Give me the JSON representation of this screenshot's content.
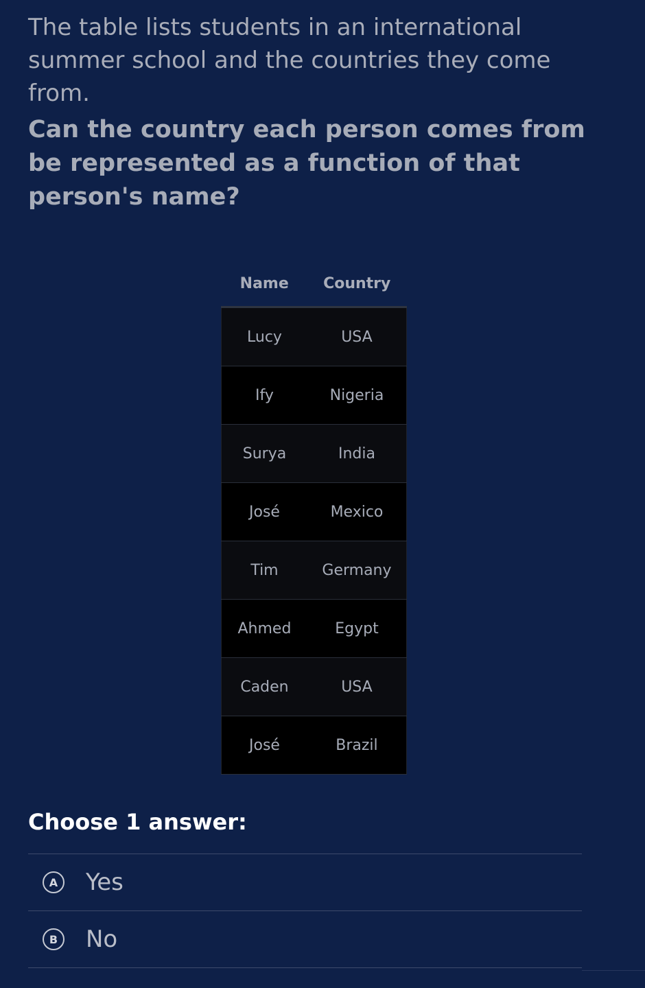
{
  "intro": "The table lists students in an international summer school and the countries they come from.",
  "question": "Can the country each person comes from be represented as a function of that person's name?",
  "table": {
    "headers": [
      "Name",
      "Country"
    ],
    "rows": [
      [
        "Lucy",
        "USA"
      ],
      [
        "Ify",
        "Nigeria"
      ],
      [
        "Surya",
        "India"
      ],
      [
        "José",
        "Mexico"
      ],
      [
        "Tim",
        "Germany"
      ],
      [
        "Ahmed",
        "Egypt"
      ],
      [
        "Caden",
        "USA"
      ],
      [
        "José",
        "Brazil"
      ]
    ]
  },
  "prompt": "Choose 1 answer:",
  "choices": [
    {
      "letter": "A",
      "text": "Yes"
    },
    {
      "letter": "B",
      "text": "No"
    }
  ],
  "colors": {
    "background": "#0e2048",
    "text": "#a7acb8",
    "table_row_dark": "#0b0c10",
    "table_row_black": "#000000"
  }
}
